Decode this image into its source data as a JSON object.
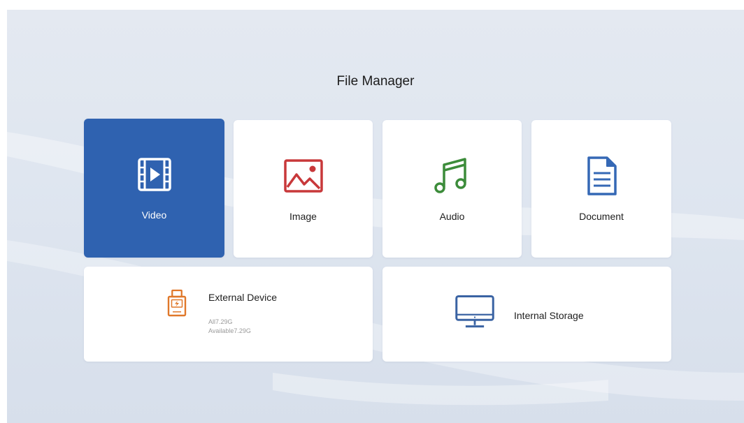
{
  "title": "File Manager",
  "categories": [
    {
      "label": "Video",
      "icon": "video-icon",
      "selected": true
    },
    {
      "label": "Image",
      "icon": "image-icon",
      "selected": false
    },
    {
      "label": "Audio",
      "icon": "music-note-icon",
      "selected": false
    },
    {
      "label": "Document",
      "icon": "document-icon",
      "selected": false
    }
  ],
  "storage": {
    "external": {
      "label": "External Device",
      "all": "All7.29G",
      "available": "Available7.29G",
      "icon": "usb-drive-icon"
    },
    "internal": {
      "label": "Internal Storage",
      "icon": "monitor-icon"
    }
  },
  "colors": {
    "selected_tile": "#2f62b0",
    "image_icon": "#c8383a",
    "audio_icon": "#3c8c3a",
    "document_icon": "#3568b5",
    "external_icon": "#e0782a",
    "internal_icon": "#3a63a3"
  }
}
